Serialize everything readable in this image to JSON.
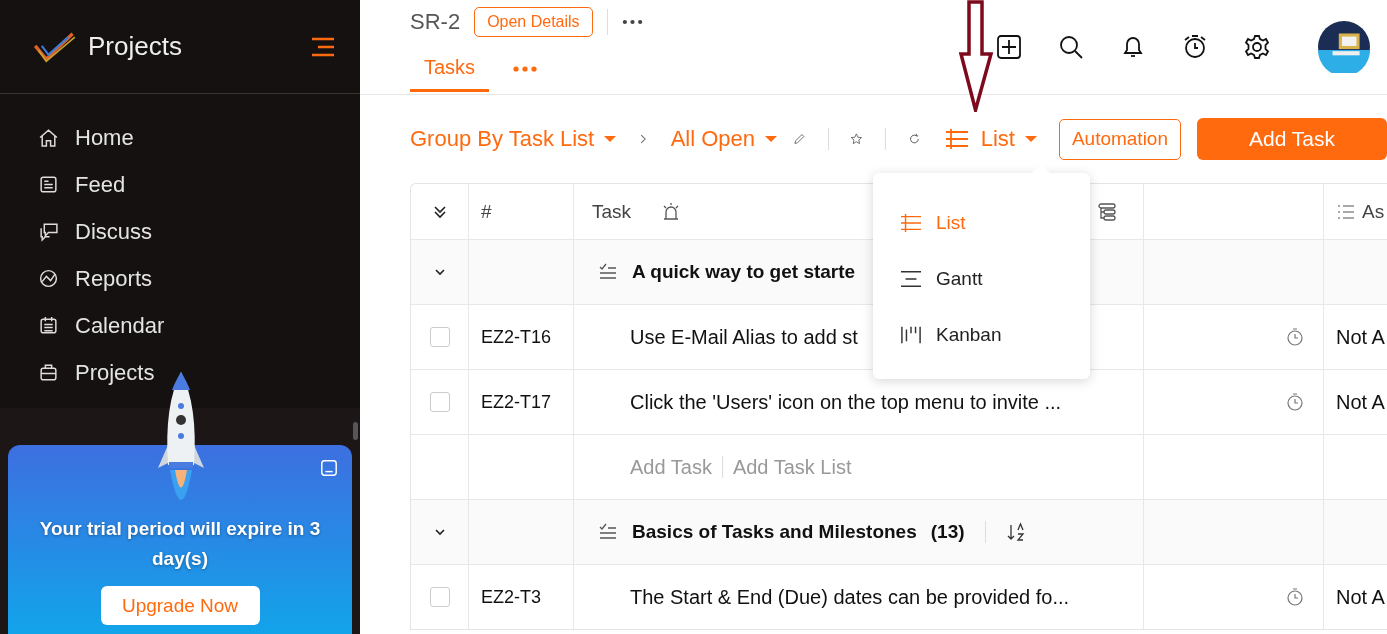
{
  "sidebar": {
    "brand": "Projects",
    "nav": [
      {
        "label": "Home"
      },
      {
        "label": "Feed"
      },
      {
        "label": "Discuss"
      },
      {
        "label": "Reports"
      },
      {
        "label": "Calendar"
      },
      {
        "label": "Projects"
      }
    ]
  },
  "promo": {
    "message": "Your trial period will expire in 3 day(s)",
    "button": "Upgrade Now"
  },
  "header": {
    "project": "SR-2",
    "details_button": "Open Details",
    "tabs": [
      {
        "label": "Tasks",
        "selected": true
      }
    ]
  },
  "toolbar": {
    "group_by": "Group By Task List",
    "filter": "All Open",
    "view": "List",
    "automation": "Automation",
    "add_task": "Add Task"
  },
  "view_menu": [
    {
      "label": "List",
      "selected": true
    },
    {
      "label": "Gantt",
      "selected": false
    },
    {
      "label": "Kanban",
      "selected": false
    }
  ],
  "table": {
    "columns": [
      "#",
      "Task",
      "As"
    ],
    "rows": [
      {
        "kind": "group",
        "title": "A quick way to get starte",
        "expanded": true
      },
      {
        "kind": "task",
        "id": "EZ2-T16",
        "title": "Use E-Mail Alias to add st",
        "checked": false,
        "status": "Not A"
      },
      {
        "kind": "task",
        "id": "EZ2-T17",
        "title": "Click the 'Users' icon on the top menu to invite ...",
        "checked": false,
        "status": "Not A"
      },
      {
        "kind": "add",
        "links": [
          "Add Task",
          "Add Task List"
        ]
      },
      {
        "kind": "group",
        "title": "Basics of Tasks and Milestones",
        "count": "(13)",
        "expanded": true
      },
      {
        "kind": "task",
        "id": "EZ2-T3",
        "title": "The Start & End (Due) dates can be provided fo...",
        "checked": false,
        "status": "Not A"
      }
    ]
  }
}
